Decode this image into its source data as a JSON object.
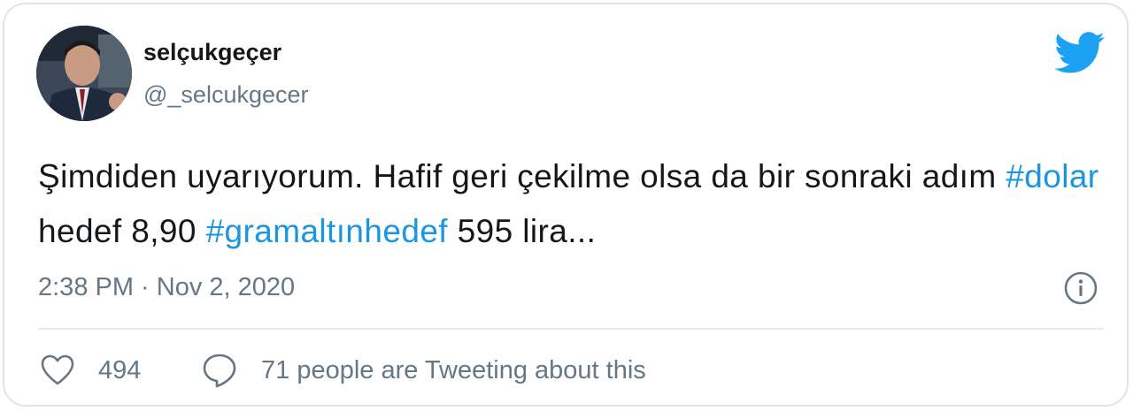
{
  "author": {
    "display_name": "selçukgeçer",
    "handle": "@_selcukgecer"
  },
  "tweet": {
    "text_part1": "Şimdiden uyarıyorum. Hafif geri çekilme olsa da bir sonraki adım ",
    "hashtag1": "#dolar",
    "text_part2": " hedef 8,90 ",
    "hashtag2": "#gramaltınhedef",
    "text_part3": " 595 lira..."
  },
  "timestamp": "2:38 PM · Nov 2, 2020",
  "actions": {
    "likes_count": "494",
    "conversation_label": "71 people are Tweeting about this"
  },
  "colors": {
    "brand": "#1da1f2",
    "hashtag": "#1b95e0",
    "text": "#14171a",
    "secondary": "#657786"
  },
  "icons": {
    "logo": "twitter-bird-icon",
    "info": "info-icon",
    "like": "heart-icon",
    "reply": "speech-bubble-icon"
  }
}
